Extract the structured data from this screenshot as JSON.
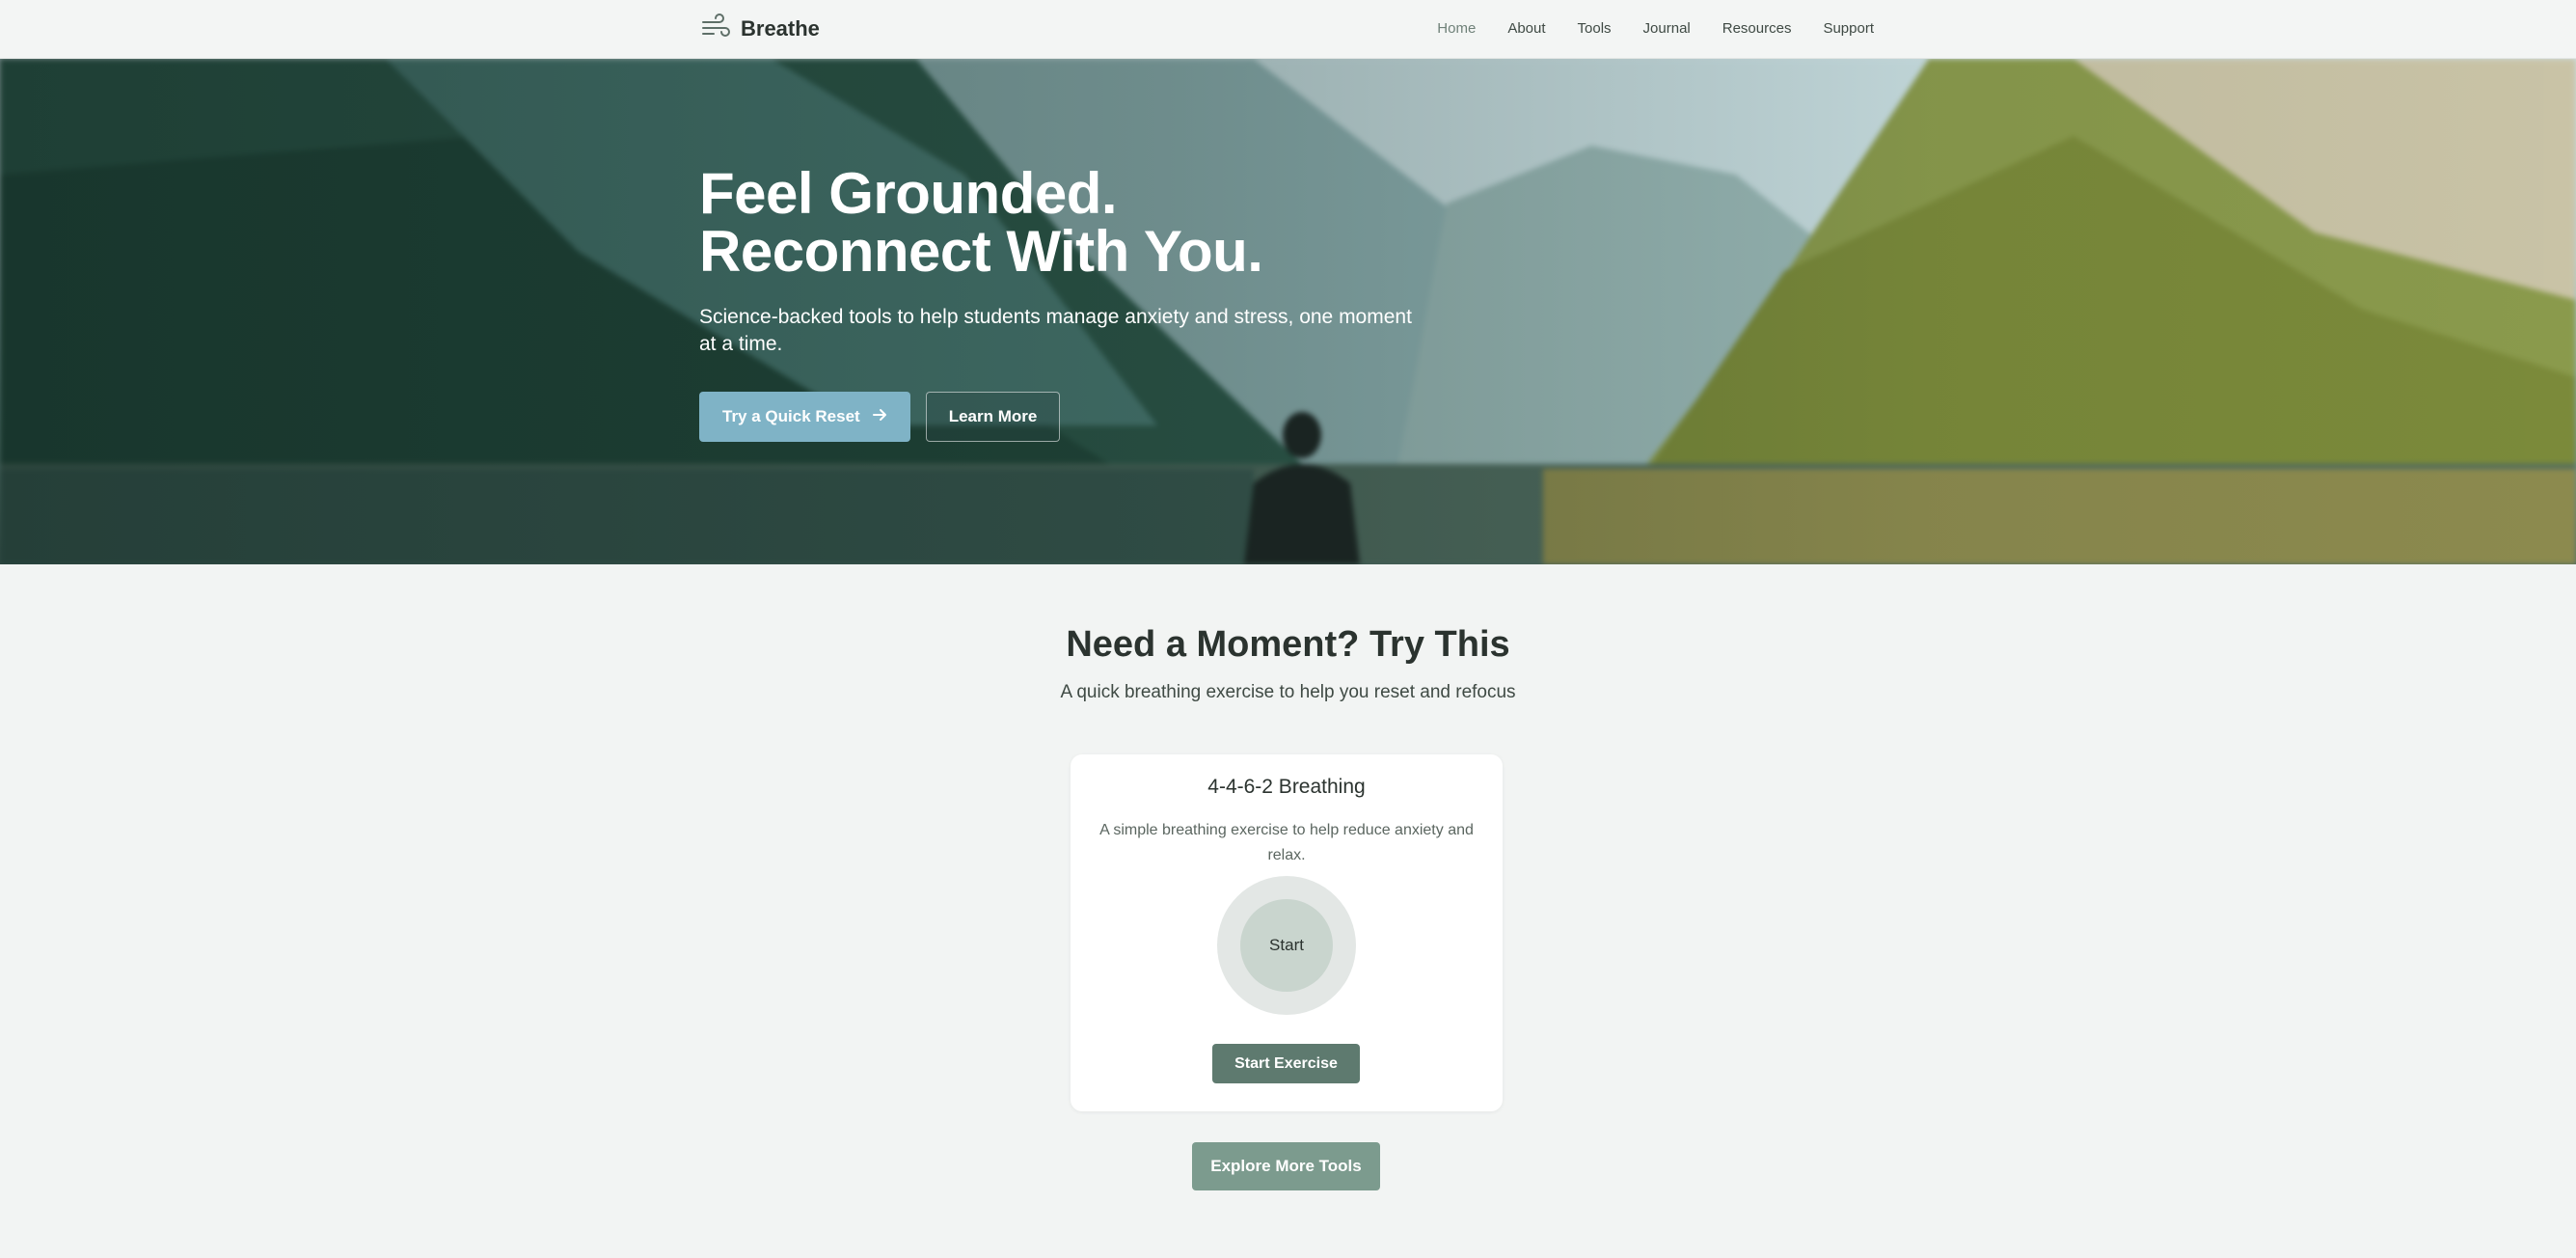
{
  "brand": {
    "name": "Breathe",
    "icon": "wind-icon"
  },
  "nav": {
    "items": [
      {
        "label": "Home",
        "active": true
      },
      {
        "label": "About",
        "active": false
      },
      {
        "label": "Tools",
        "active": false
      },
      {
        "label": "Journal",
        "active": false
      },
      {
        "label": "Resources",
        "active": false
      },
      {
        "label": "Support",
        "active": false
      }
    ]
  },
  "hero": {
    "title_line1": "Feel Grounded.",
    "title_line2": "Reconnect With You.",
    "subtitle": "Science-backed tools to help students manage anxiety and stress, one moment at a time.",
    "primary_button": "Try a Quick Reset",
    "primary_icon": "arrow-right-icon",
    "secondary_button": "Learn More"
  },
  "section": {
    "title": "Need a Moment? Try This",
    "subtitle": "A quick breathing exercise to help you reset and refocus"
  },
  "card": {
    "title": "4-4-6-2 Breathing",
    "description": "A simple breathing exercise to help reduce anxiety and relax.",
    "circle_label": "Start",
    "button": "Start Exercise"
  },
  "explore_button": "Explore More Tools",
  "colors": {
    "background": "#f2f4f3",
    "primary_button": "#7fb3c6",
    "start_button": "#5e7a6f",
    "explore_button": "#7c9b8e"
  }
}
